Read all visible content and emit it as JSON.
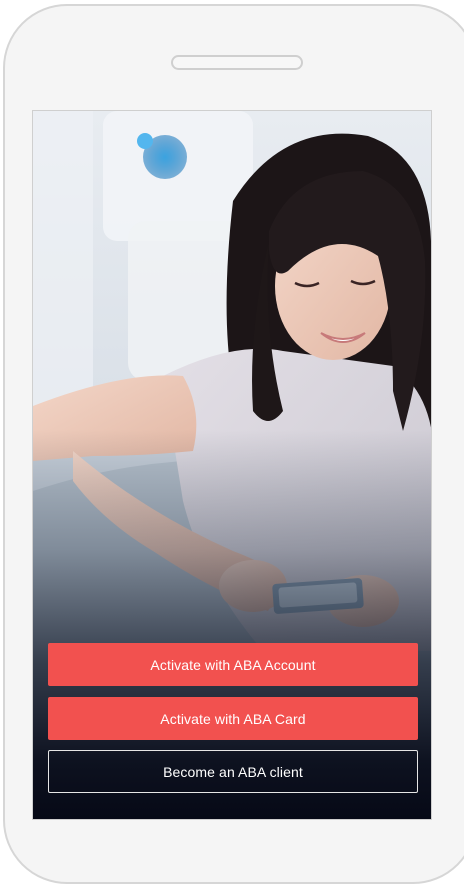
{
  "screen": {
    "photo_icon": "woman-using-phone-photo"
  },
  "actions": {
    "activate_account_label": "Activate with ABA Account",
    "activate_card_label": "Activate with ABA Card",
    "become_client_label": "Become an ABA client"
  },
  "colors": {
    "primary_button": "#f2514f",
    "outline_border": "#e6e6e6",
    "bottom_overlay": "#060916"
  }
}
